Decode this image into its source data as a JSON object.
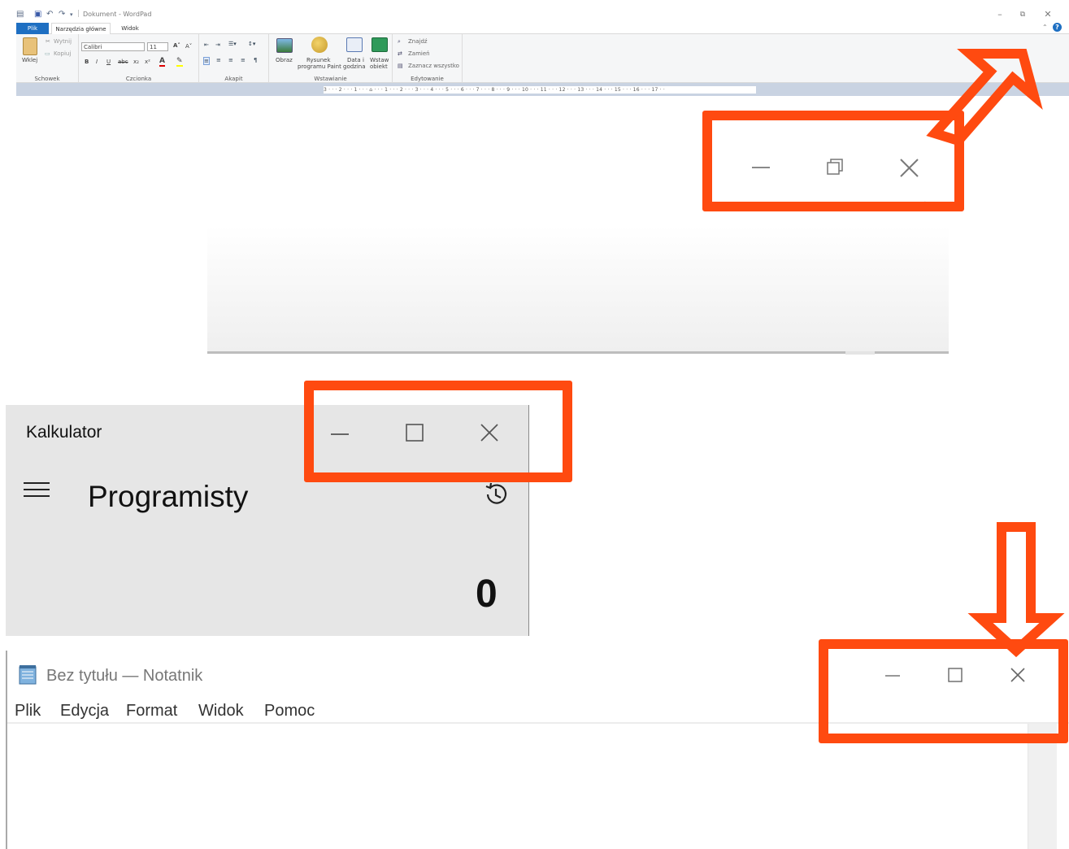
{
  "wordpad": {
    "title": "Dokument - WordPad",
    "tabs": {
      "file": "Plik",
      "home": "Narzędzia główne",
      "view": "Widok"
    },
    "groups": {
      "clipboard": {
        "label": "Schowek",
        "paste": "Wklej",
        "cut": "Wytnij",
        "copy": "Kopiuj"
      },
      "font": {
        "label": "Czcionka",
        "font_name": "Calibri",
        "font_size": "11"
      },
      "paragraph": {
        "label": "Akapit"
      },
      "insert": {
        "label": "Wstawianie",
        "image": "Obraz",
        "paint_1": "Rysunek",
        "paint_2": "programu Paint",
        "datetime_1": "Data i",
        "datetime_2": "godzina",
        "object_1": "Wstaw",
        "object_2": "obiekt"
      },
      "editing": {
        "label": "Edytowanie",
        "find": "Znajdź",
        "replace": "Zamień",
        "select_all": "Zaznacz wszystko"
      }
    },
    "ruler": "3 · · · 2 · · · 1 · · · ⌂ · · · 1 · · · 2 · · · 3 · · · 4 · · · 5 · · · 6 · · · 7 · · · 8 · · · 9 · · · 10 · · · 11 · · · 12 · · · 13 · · · 14 · · · 15 · · · 16 · · · 17 · ·"
  },
  "calculator": {
    "title": "Kalkulator",
    "mode": "Programisty",
    "display": "0"
  },
  "notepad": {
    "title": "Bez tytułu — Notatnik",
    "menu": [
      "Plik",
      "Edycja",
      "Format",
      "Widok",
      "Pomoc"
    ]
  },
  "colors": {
    "highlight": "#ff4a10",
    "ribbon_file_tab": "#1e6fc2",
    "calculator_bg": "#e6e6e6",
    "ruler_bg": "#c9d3e2"
  },
  "icons": [
    "minimize-icon",
    "maximize-icon",
    "restore-icon",
    "close-icon",
    "hamburger-icon",
    "history-icon",
    "notepad-app-icon",
    "help-icon"
  ]
}
